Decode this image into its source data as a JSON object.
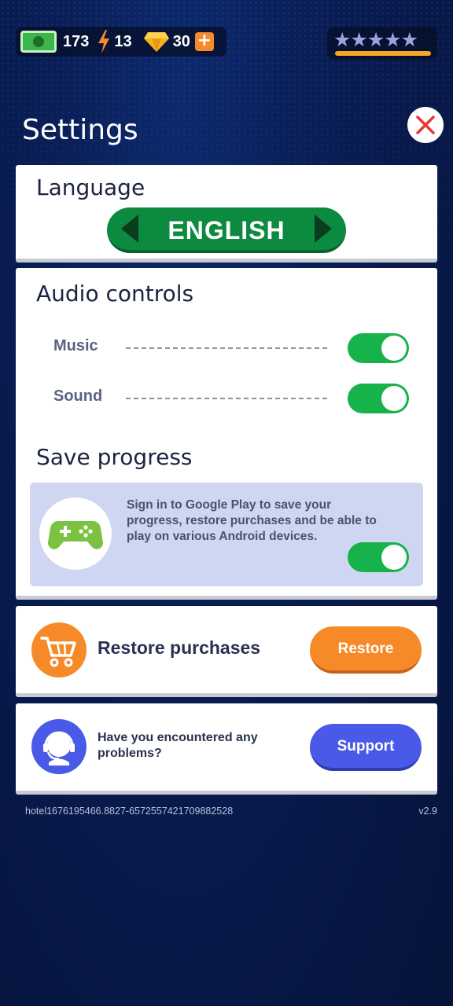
{
  "topbar": {
    "cash": "173",
    "energy": "13",
    "gems": "30",
    "plus_label": "+",
    "stars": "★★★★★",
    "icons": {
      "cash": "cash-icon",
      "energy": "bolt-icon",
      "gems": "gem-icon",
      "add": "plus-icon"
    }
  },
  "header": {
    "title": "Settings",
    "close_icon": "close-icon"
  },
  "language": {
    "title": "Language",
    "selected": "ENGLISH"
  },
  "audio": {
    "title": "Audio controls",
    "music_label": "Music",
    "music_on": true,
    "sound_label": "Sound",
    "sound_on": true
  },
  "save": {
    "title": "Save progress",
    "description": "Sign in to Google Play to save your progress, restore purchases and be able to play on various Android devices.",
    "enabled": true
  },
  "restore": {
    "label": "Restore purchases",
    "button": "Restore"
  },
  "support": {
    "label": "Have you encountered any problems?",
    "button": "Support"
  },
  "footer": {
    "id": "hotel1676195466.8827-6572557421709882528",
    "version": "v2.9"
  },
  "colors": {
    "background": "#08194a",
    "toggle_on": "#16b24a",
    "language_green": "#0c8a3f",
    "restore_orange": "#f68a28",
    "support_blue": "#4a5ae8",
    "close_red": "#e53935"
  }
}
